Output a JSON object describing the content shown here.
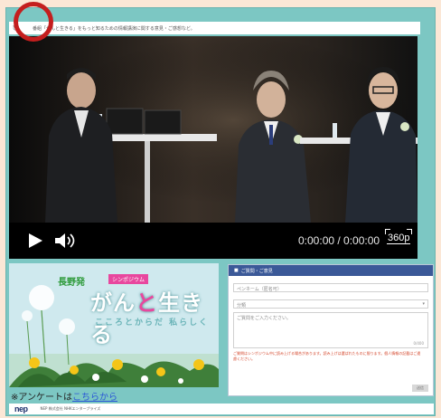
{
  "page": {
    "title_bar": "番組「がんと生きる」をもっと知るための情報講演に関する意見・ご感想など。",
    "reload_icon": "reload-icon"
  },
  "video": {
    "time_display": "0:00:00 / 0:00:00",
    "quality": "360p",
    "controls": [
      "play-icon",
      "volume-icon",
      "quality-icon"
    ]
  },
  "banner": {
    "program_label": "長野発",
    "program_sub": "シンポジウム",
    "title_part1": "がん",
    "title_part2": "と",
    "title_part3": "生きる",
    "tagline": "こころとからだ 私らしく"
  },
  "survey": {
    "prefix": "※アンケートは",
    "link": "こちらから"
  },
  "form": {
    "header": "ご質問・ご意見",
    "name_placeholder": "ペンネーム（匿名可）",
    "category_value": "分類",
    "question_placeholder": "ご質問をご入力ください。",
    "char_count": "0/400",
    "notice": "ご質問はシンポジウム中に読み上げる場合があります。読み上げは選ばれたものに限ります。個人情報の記載はご遠慮ください。",
    "submit_label": "送信"
  },
  "footer": {
    "logo": "nep",
    "copyright": "NEP 株式会社 NHKエンタープライズ"
  },
  "colors": {
    "page_bg": "#fbe7d6",
    "frame_bg": "#7cc7c3",
    "form_header": "#3b5998",
    "accent_pink": "#e8479e",
    "link": "#2b57d6",
    "marker": "#c41e1e"
  }
}
